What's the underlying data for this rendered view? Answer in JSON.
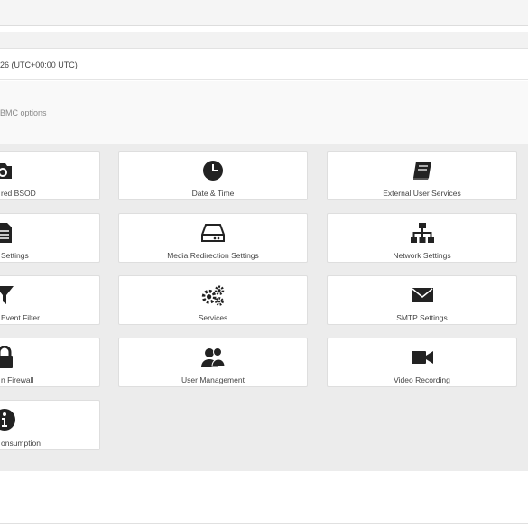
{
  "header": {
    "time": "26 (UTC+00:00 UTC)",
    "options_text": "BMC options"
  },
  "tiles": [
    {
      "label": "red BSOD",
      "icon": "camera-icon"
    },
    {
      "label": "Date & Time",
      "icon": "clock-icon"
    },
    {
      "label": "External User Services",
      "icon": "book-icon"
    },
    {
      "label": "Settings",
      "icon": "document-icon"
    },
    {
      "label": "Media Redirection Settings",
      "icon": "hard-drive-icon"
    },
    {
      "label": "Network Settings",
      "icon": "sitemap-icon"
    },
    {
      "label": "Event Filter",
      "icon": "filter-icon"
    },
    {
      "label": "Services",
      "icon": "gears-icon"
    },
    {
      "label": "SMTP Settings",
      "icon": "envelope-icon"
    },
    {
      "label": "n Firewall",
      "icon": "lock-icon"
    },
    {
      "label": "User Management",
      "icon": "users-icon"
    },
    {
      "label": "Video Recording",
      "icon": "video-camera-icon"
    },
    {
      "label": "onsumption",
      "icon": "info-icon"
    }
  ],
  "colors": {
    "icon": "#222222",
    "grid_background": "#ececec",
    "tile_background": "#ffffff"
  }
}
